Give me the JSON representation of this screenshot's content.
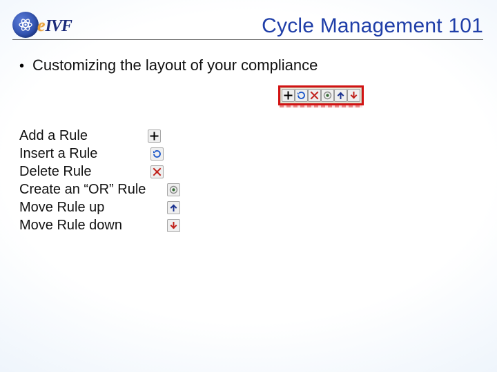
{
  "header": {
    "logo_e": "e",
    "logo_ivf": "IVF",
    "title": "Cycle Management 101"
  },
  "bullet": {
    "text": "Customizing the layout of your compliance"
  },
  "toolbar": {
    "buttons": [
      {
        "name": "add-rule-icon"
      },
      {
        "name": "insert-rule-icon"
      },
      {
        "name": "delete-rule-icon"
      },
      {
        "name": "or-rule-icon"
      },
      {
        "name": "move-up-icon"
      },
      {
        "name": "move-down-icon"
      }
    ]
  },
  "legend": {
    "items": [
      {
        "label": "Add a Rule",
        "icon": "add-rule-icon"
      },
      {
        "label": "Insert a Rule",
        "icon": "insert-rule-icon"
      },
      {
        "label": "Delete Rule",
        "icon": "delete-rule-icon"
      },
      {
        "label": "Create an “OR” Rule",
        "icon": "or-rule-icon"
      },
      {
        "label": "Move Rule up",
        "icon": "move-up-icon"
      },
      {
        "label": "Move Rule down",
        "icon": "move-down-icon"
      }
    ]
  },
  "icons": {
    "add-rule-icon": {
      "glyph": "plus",
      "color": "#000000"
    },
    "insert-rule-icon": {
      "glyph": "insert",
      "color": "#1653c9"
    },
    "delete-rule-icon": {
      "glyph": "x",
      "color": "#c0201a"
    },
    "or-rule-icon": {
      "glyph": "radio",
      "color": "#6a6a6a"
    },
    "move-up-icon": {
      "glyph": "arrow-up",
      "color": "#18308f"
    },
    "move-down-icon": {
      "glyph": "arrow-down",
      "color": "#c0201a"
    }
  }
}
